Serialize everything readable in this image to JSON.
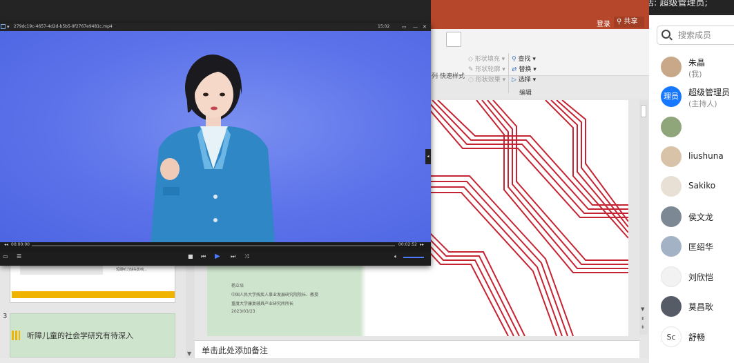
{
  "meeting": {
    "speaking_label": "正在讲话: 超级管理员;"
  },
  "ppt": {
    "login_label": "登录",
    "share_label": "共享",
    "ribbon": {
      "col_label": "列",
      "quick_style": "快速样式",
      "shape_fill": "形状填充",
      "shape_outline": "形状轮廓",
      "shape_effect": "形状效果",
      "find": "查找",
      "replace": "替换",
      "select": "选择",
      "group_edit": "编辑"
    },
    "slide_number": "3",
    "thumb3_title": "听障儿童的社会学研究有待深入",
    "thumb2_caption": "· 短期听力缺失影响...",
    "slide_lines": [
      "杨立培",
      "中国人民大学残疾人事业发展研究院院长、教授",
      "重度大学康复辅具产业研究所所长",
      "2023/03/23"
    ],
    "notes_placeholder": "单击此处添加备注"
  },
  "player": {
    "file_name": "279dc19c-4657-4d2d-b5b5-9f2767e9481c.mp4",
    "clock": "15:02",
    "time_current": "00:00:00",
    "time_total": "00:02:52",
    "progress": 0,
    "volume": 1.0
  },
  "members": {
    "search_placeholder": "搜索成员",
    "list": [
      {
        "name": "朱晶",
        "role": "(我)",
        "avatar_bg": "#c9a88a",
        "avatar_text": ""
      },
      {
        "name": "超级管理员",
        "role": "(主持人)",
        "avatar_bg": "#1677ff",
        "avatar_text": "理员"
      },
      {
        "name": "",
        "role": "",
        "avatar_bg": "#8fa57a",
        "avatar_text": ""
      },
      {
        "name": "liushuna",
        "role": "",
        "avatar_bg": "#d9c3a8",
        "avatar_text": ""
      },
      {
        "name": "Sakiko",
        "role": "",
        "avatar_bg": "#e8e0d4",
        "avatar_text": ""
      },
      {
        "name": "侯文龙",
        "role": "",
        "avatar_bg": "#7c8894",
        "avatar_text": ""
      },
      {
        "name": "匡绍华",
        "role": "",
        "avatar_bg": "#a3b2c4",
        "avatar_text": ""
      },
      {
        "name": "刘欣恺",
        "role": "",
        "avatar_bg": "#f2f2f2",
        "avatar_text": ""
      },
      {
        "name": "莫昌耿",
        "role": "",
        "avatar_bg": "#555c66",
        "avatar_text": ""
      },
      {
        "name": "舒畅",
        "role": "",
        "avatar_bg": "#ffffff",
        "avatar_text": "Sc"
      }
    ]
  }
}
